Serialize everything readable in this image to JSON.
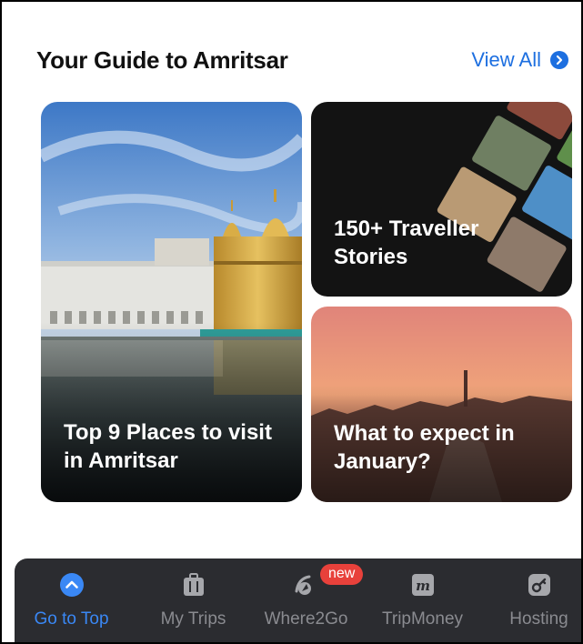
{
  "header": {
    "title": "Your Guide to Amritsar",
    "view_all": "View All"
  },
  "cards": {
    "main": "Top 9 Places to visit in Amritsar",
    "stories": "150+ Traveller Stories",
    "january": "What to expect in January?"
  },
  "tabbar": {
    "tabs": [
      {
        "label": "Go to Top",
        "icon": "chevron-up-icon",
        "active": true
      },
      {
        "label": "My Trips",
        "icon": "suitcase-icon"
      },
      {
        "label": "Where2Go",
        "icon": "compass-icon",
        "badge": "new"
      },
      {
        "label": "TripMoney",
        "icon": "tripmoney-logo-icon"
      },
      {
        "label": "Hosting",
        "icon": "key-icon"
      }
    ]
  },
  "colors": {
    "accent": "#1d6fe0",
    "tab_active": "#3a88f5",
    "tabbar_bg": "#2b2c30",
    "badge": "#e8413b"
  }
}
